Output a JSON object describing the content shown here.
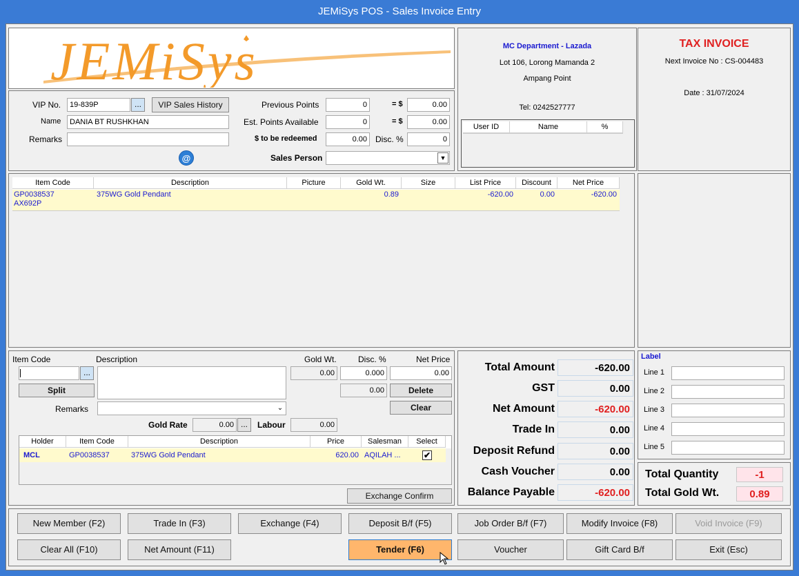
{
  "window": {
    "title": "JEMiSys POS - Sales Invoice Entry"
  },
  "logo": {
    "text": "JEMiSys"
  },
  "store": {
    "name": "MC Department - Lazada",
    "address1": "Lot 106, Lorong Mamanda 2",
    "address2": "Ampang Point",
    "tel": "Tel: 0242527777"
  },
  "invoice": {
    "heading": "TAX INVOICE",
    "next_no": "Next Invoice No : CS-004483",
    "date": "Date : 31/07/2024"
  },
  "staff_table": {
    "headers": [
      "User ID",
      "Name",
      "%"
    ]
  },
  "member": {
    "vip_label": "VIP No.",
    "vip_value": "19-839P",
    "browse": "...",
    "history_btn": "VIP Sales History",
    "name_label": "Name",
    "name_value": "DANIA BT RUSHKHAN",
    "remarks_label": "Remarks",
    "remarks_value": "",
    "email_icon": "@"
  },
  "points": {
    "prev_label": "Previous Points",
    "prev_value": "0",
    "prev_eq": "= $",
    "prev_amount": "0.00",
    "est_label": "Est. Points Available",
    "est_value": "0",
    "est_eq": "= $",
    "est_amount": "0.00",
    "redeem_label": "$ to be redeemed",
    "redeem_value": "0.00",
    "disc_label": "Disc. %",
    "disc_value": "0",
    "salesperson_label": "Sales Person",
    "salesperson_value": ""
  },
  "items_grid": {
    "headers": [
      "Item Code",
      "Description",
      "Picture",
      "Gold Wt.",
      "Size",
      "List Price",
      "Discount",
      "Net Price"
    ],
    "rows": [
      {
        "code": "GP0038537",
        "code2": "AX692P",
        "description": "375WG Gold Pendant",
        "picture": "",
        "gold_wt": "0.89",
        "size": "",
        "list_price": "-620.00",
        "discount": "0.00",
        "net_price": "-620.00"
      }
    ]
  },
  "entry": {
    "item_code_label": "Item Code",
    "desc_label": "Description",
    "gold_wt_label": "Gold Wt.",
    "disc_label": "Disc. %",
    "net_label": "Net Price",
    "item_code_value": "",
    "browse": "...",
    "gold_wt_value": "0.00",
    "disc_value": "0.000",
    "net_value": "0.00",
    "extra_value": "0.00",
    "split_btn": "Split",
    "delete_btn": "Delete",
    "clear_btn": "Clear",
    "remarks_label": "Remarks",
    "remarks_value": "",
    "gold_rate_label": "Gold Rate",
    "gold_rate_value": "0.00",
    "gold_rate_browse": "...",
    "labour_label": "Labour",
    "labour_value": "0.00"
  },
  "exchange_grid": {
    "headers": [
      "Holder",
      "Item Code",
      "Description",
      "Price",
      "Salesman",
      "Select"
    ],
    "rows": [
      {
        "holder": "MCL",
        "code": "GP0038537",
        "description": "375WG Gold Pendant",
        "price": "620.00",
        "salesman": "AQILAH ...",
        "selected": true
      }
    ],
    "confirm_btn": "Exchange Confirm"
  },
  "totals": {
    "total_amount_label": "Total Amount",
    "total_amount": "-620.00",
    "gst_label": "GST",
    "gst": "0.00",
    "net_amount_label": "Net Amount",
    "net_amount": "-620.00",
    "trade_in_label": "Trade In",
    "trade_in": "0.00",
    "deposit_label": "Deposit Refund",
    "deposit": "0.00",
    "cash_voucher_label": "Cash Voucher",
    "cash_voucher": "0.00",
    "balance_label": "Balance Payable",
    "balance": "-620.00"
  },
  "labels_panel": {
    "title": "Label",
    "lines": [
      "Line 1",
      "Line 2",
      "Line 3",
      "Line 4",
      "Line 5"
    ]
  },
  "summary": {
    "qty_label": "Total Quantity",
    "qty": "-1",
    "gold_label": "Total Gold Wt.",
    "gold": "0.89"
  },
  "buttons": {
    "new_member": "New Member (F2)",
    "trade_in": "Trade In (F3)",
    "exchange": "Exchange (F4)",
    "deposit": "Deposit B/f (F5)",
    "job_order": "Job Order B/f (F7)",
    "modify": "Modify Invoice (F8)",
    "void": "Void Invoice (F9)",
    "clear_all": "Clear All (F10)",
    "net_amount": "Net Amount (F11)",
    "tender": "Tender (F6)",
    "voucher": "Voucher",
    "gift_card": "Gift Card B/f",
    "exit": "Exit (Esc)"
  },
  "colors": {
    "accent_orange": "#ffb66c",
    "title_blue": "#3a7bd5",
    "row_yellow": "#fffacd",
    "text_blue": "#1a1ad0",
    "text_red": "#e02020"
  }
}
